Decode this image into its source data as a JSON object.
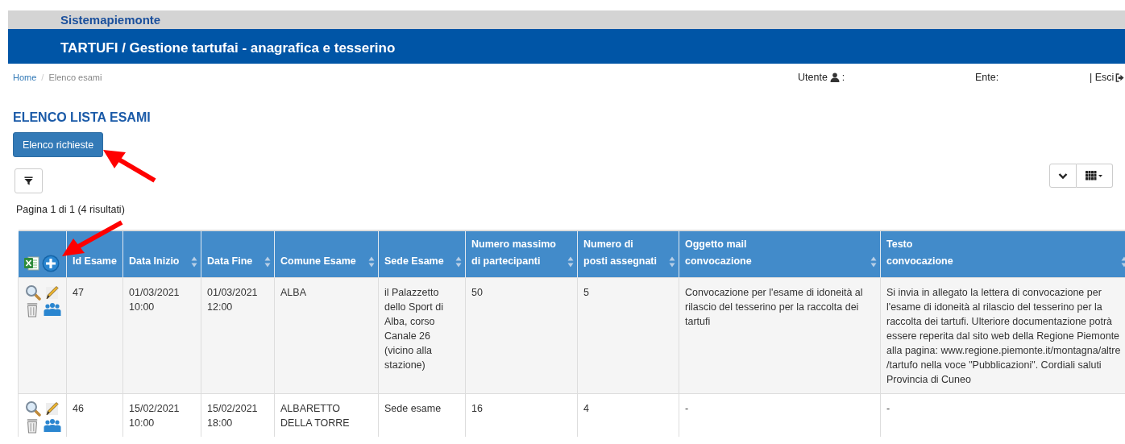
{
  "brand": "Sistemapiemonte",
  "app_title": "TARTUFI / Gestione tartufai - anagrafica e tesserino",
  "breadcrumb": [
    {
      "label": "Home",
      "kind": "link"
    },
    {
      "label": "/",
      "kind": "separator"
    },
    {
      "label": "Elenco esami",
      "kind": "current"
    }
  ],
  "user_bar": {
    "user_label": "Utente",
    "user_suffix": ":",
    "ente_label": "Ente:",
    "logout": "| Esci"
  },
  "heading": "ELENCO LISTA ESAMI",
  "primary_button": "Elenco richieste",
  "pagination": "Pagina 1 di 1 (4 risultati)",
  "table": {
    "columns": [
      {
        "label": "Id Esame",
        "sortable": false
      },
      {
        "label": "Data Inizio",
        "sortable": true
      },
      {
        "label": "Data Fine",
        "sortable": true
      },
      {
        "label": "Comune Esame",
        "sortable": true
      },
      {
        "label": "Sede Esame",
        "sortable": true
      },
      {
        "label": "Numero massimo\ndi partecipanti",
        "sortable": true
      },
      {
        "label": "Numero di\nposti assegnati",
        "sortable": true
      },
      {
        "label": "Oggetto mail\nconvocazione",
        "sortable": true
      },
      {
        "label": "Testo\nconvocazione",
        "sortable": true
      }
    ],
    "rows": [
      {
        "cells": [
          "47",
          "01/03/2021\n10:00",
          "01/03/2021\n12:00",
          "ALBA",
          "il Palazzetto dello Sport di Alba, corso Canale 26 (vicino alla stazione)",
          "50",
          "5",
          "Convocazione per l'esame di idoneità al rilascio del tesserino per la raccolta dei tartufi",
          "Si invia in allegato la lettera di convocazione per l'esame di idoneità al rilascio del tesserino per la raccolta dei tartufi. Ulteriore documentazione potrà essere reperita dal sito web della Regione Piemonte alla pagina: www.regione.piemonte.it/montagna/altre\n/tartufo nella voce \"Pubblicazioni\". Cordiali saluti Provincia di Cuneo"
        ]
      },
      {
        "cells": [
          "46",
          "15/02/2021\n10:00",
          "15/02/2021\n18:00",
          "ALBARETTO DELLA TORRE",
          "Sede esame",
          "16",
          "4",
          "-",
          "-"
        ]
      }
    ]
  }
}
